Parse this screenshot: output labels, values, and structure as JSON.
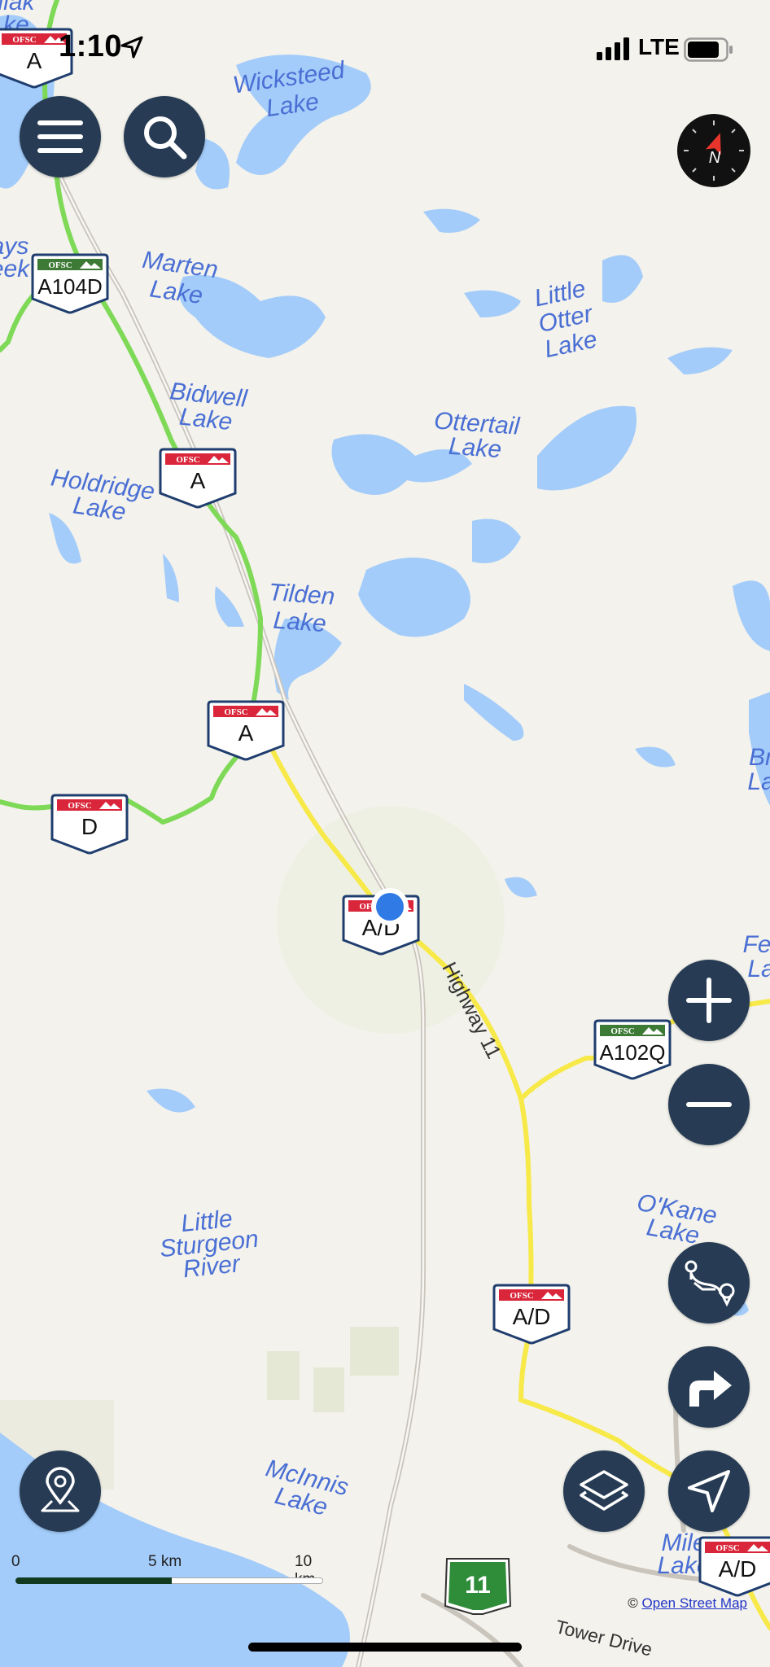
{
  "status_bar": {
    "time": "1:10",
    "network": "LTE"
  },
  "lakes": [
    {
      "lines": [
        "Wicksteed",
        "Lake"
      ]
    },
    {
      "lines": [
        "Marten",
        "Lake"
      ]
    },
    {
      "lines": [
        "Little",
        "Otter",
        "Lake"
      ]
    },
    {
      "lines": [
        "Bidwell",
        "Lake"
      ]
    },
    {
      "lines": [
        "Ottertail",
        "Lake"
      ]
    },
    {
      "lines": [
        "Holdridge",
        "Lake"
      ]
    },
    {
      "lines": [
        "Tilden",
        "Lake"
      ]
    },
    {
      "lines": [
        "Little",
        "Sturgeon",
        "River"
      ]
    },
    {
      "lines": [
        "O'Kane",
        "Lake"
      ]
    },
    {
      "lines": [
        "McInnis",
        "Lake"
      ]
    },
    {
      "lines": [
        "Mile",
        "Lake"
      ]
    },
    {
      "lines": [
        "Br",
        "La"
      ]
    },
    {
      "lines": [
        "Fer",
        "La"
      ]
    },
    {
      "lines": [
        "ays",
        "eek"
      ]
    },
    {
      "lines": [
        "llak",
        "ke"
      ]
    }
  ],
  "roads": {
    "highway_label": "Highway 11",
    "street_label": "Tower Drive",
    "highway_shield_number": "11"
  },
  "trail_markers": [
    {
      "org": "OFSC",
      "code": "A",
      "color": "#d9263a"
    },
    {
      "org": "OFSC",
      "code": "A104D",
      "color": "#3d7a35"
    },
    {
      "org": "OFSC",
      "code": "A",
      "color": "#d9263a"
    },
    {
      "org": "OFSC",
      "code": "A",
      "color": "#d9263a"
    },
    {
      "org": "OFSC",
      "code": "D",
      "color": "#d9263a"
    },
    {
      "org": "OFSC",
      "code": "A/D",
      "color": "#d9263a"
    },
    {
      "org": "OFSC",
      "code": "A102Q",
      "color": "#3d7a35"
    },
    {
      "org": "OFSC",
      "code": "A/D",
      "color": "#d9263a"
    },
    {
      "org": "OFSC",
      "code": "A/D",
      "color": "#d9263a"
    }
  ],
  "scale_bar": {
    "labels": [
      "0",
      "5 km",
      "10 km"
    ]
  },
  "attribution": {
    "prefix": "©",
    "link": "Open Street Map"
  },
  "controls": {
    "menu": "hamburger-icon",
    "search": "search-icon",
    "compass": "compass-icon",
    "zoom_in": "plus-icon",
    "zoom_out": "minus-icon",
    "route": "route-icon",
    "directions": "turn-arrow-icon",
    "layers": "layers-icon",
    "locate": "navigation-arrow-icon",
    "poi": "map-pin-icon"
  },
  "colors": {
    "trail_green": "#7ed957",
    "trail_yellow": "#f7e948",
    "water": "#a3ccfa",
    "button": "#273c54",
    "user_dot": "#2f7ae5"
  }
}
